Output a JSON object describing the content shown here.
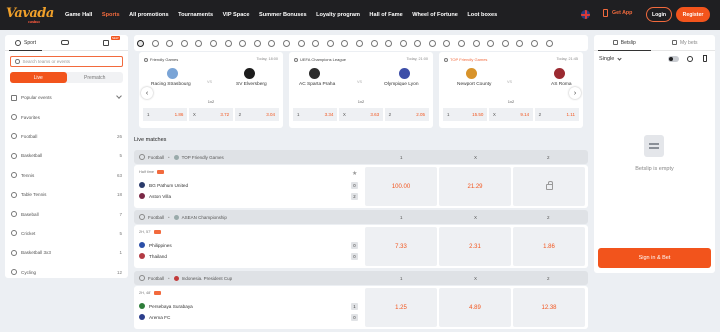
{
  "brand": {
    "logo": "Vavada",
    "logo_sub": "casino"
  },
  "nav": {
    "items": [
      "Game Hall",
      "Sports",
      "All promotions",
      "Tournaments",
      "VIP Space",
      "Summer Bonuses",
      "Loyalty program",
      "Hall of Fame",
      "Wheel of Fortune",
      "Loot boxes"
    ],
    "active": "Sports",
    "get_app": "Get App",
    "login": "Login",
    "register": "Register"
  },
  "sidebar": {
    "tabs": [
      {
        "label": "Sport",
        "icon": "ball-icon"
      },
      {
        "label": "",
        "icon": "gamepad-icon"
      },
      {
        "label": "",
        "icon": "trophy-icon",
        "badge": "NEW"
      }
    ],
    "search_placeholder": "Search teams or events",
    "toggle": [
      "Live",
      "Prematch"
    ],
    "items": [
      {
        "label": "Popular events",
        "count": "",
        "icon": "popular-icon"
      },
      {
        "label": "Favorites",
        "count": "",
        "icon": "star-icon"
      },
      {
        "label": "Football",
        "count": "26",
        "icon": "football-icon"
      },
      {
        "label": "Basketball",
        "count": "5",
        "icon": "basketball-icon"
      },
      {
        "label": "Tennis",
        "count": "63",
        "icon": "tennis-icon"
      },
      {
        "label": "Table Tennis",
        "count": "18",
        "icon": "table-tennis-icon"
      },
      {
        "label": "Baseball",
        "count": "7",
        "icon": "baseball-icon"
      },
      {
        "label": "Cricket",
        "count": "5",
        "icon": "cricket-icon"
      },
      {
        "label": "Basketball 3x3",
        "count": "1",
        "icon": "basketball-3x3-icon"
      },
      {
        "label": "Cycling",
        "count": "12",
        "icon": "cycling-icon"
      }
    ]
  },
  "featured": [
    {
      "league": "Friendly Games",
      "time": "Today, 18:00",
      "highlight": false,
      "home": "Racing Strasbourg",
      "away": "SV Elversberg",
      "vs": "VS",
      "market": "1x2",
      "odds": [
        {
          "label": "1",
          "value": "1.86"
        },
        {
          "label": "X",
          "value": "3.72"
        },
        {
          "label": "2",
          "value": "3.04"
        }
      ]
    },
    {
      "league": "UEFA Champions League",
      "time": "Today, 21:00",
      "highlight": false,
      "home": "AC Sparta Praha",
      "away": "Olympique Lyon",
      "vs": "VS",
      "market": "1x2",
      "odds": [
        {
          "label": "1",
          "value": "3.34"
        },
        {
          "label": "X",
          "value": "3.63"
        },
        {
          "label": "2",
          "value": "2.05"
        }
      ]
    },
    {
      "league": "TOP Friendly Games",
      "time": "Today, 21:45",
      "highlight": true,
      "home": "Newport County",
      "away": "AS Roma",
      "vs": "VS",
      "market": "1x2",
      "odds": [
        {
          "label": "1",
          "value": "15.50"
        },
        {
          "label": "X",
          "value": "9.14"
        },
        {
          "label": "2",
          "value": "1.11"
        }
      ]
    }
  ],
  "live_title": "Live matches",
  "live": [
    {
      "sport": "Football",
      "league": "TOP Friendly Games",
      "headers": [
        "1",
        "X",
        "2"
      ],
      "status": "Half time",
      "home": "BG Pathum United",
      "away": "Aston Villa",
      "home_score": "0",
      "away_score": "2",
      "odds": [
        "100.00",
        "21.29",
        ""
      ],
      "locked": [
        false,
        false,
        true
      ]
    },
    {
      "sport": "Football",
      "league": "ASEAN Championship",
      "headers": [
        "1",
        "X",
        "2"
      ],
      "status": "2H, 57'",
      "home": "Philippines",
      "away": "Thailand",
      "home_score": "0",
      "away_score": "0",
      "odds": [
        "7.33",
        "2.31",
        "1.86"
      ],
      "locked": [
        false,
        false,
        false
      ]
    },
    {
      "sport": "Football",
      "league": "Indonesia. President Cup",
      "headers": [
        "1",
        "X",
        "2"
      ],
      "status": "2H, 48'",
      "home": "Persebaya Surabaya",
      "away": "Arema FC",
      "home_score": "1",
      "away_score": "0",
      "odds": [
        "1.25",
        "4.89",
        "12.38"
      ],
      "locked": [
        false,
        false,
        false
      ]
    }
  ],
  "betslip": {
    "tabs": [
      "Betslip",
      "My bets"
    ],
    "mode": "Single",
    "empty": "Betslip is empty",
    "signin": "Sign in & Bet"
  },
  "colors": {
    "accent": "#f2541c",
    "topbar": "#1f1f22",
    "bg": "#eceff3"
  }
}
